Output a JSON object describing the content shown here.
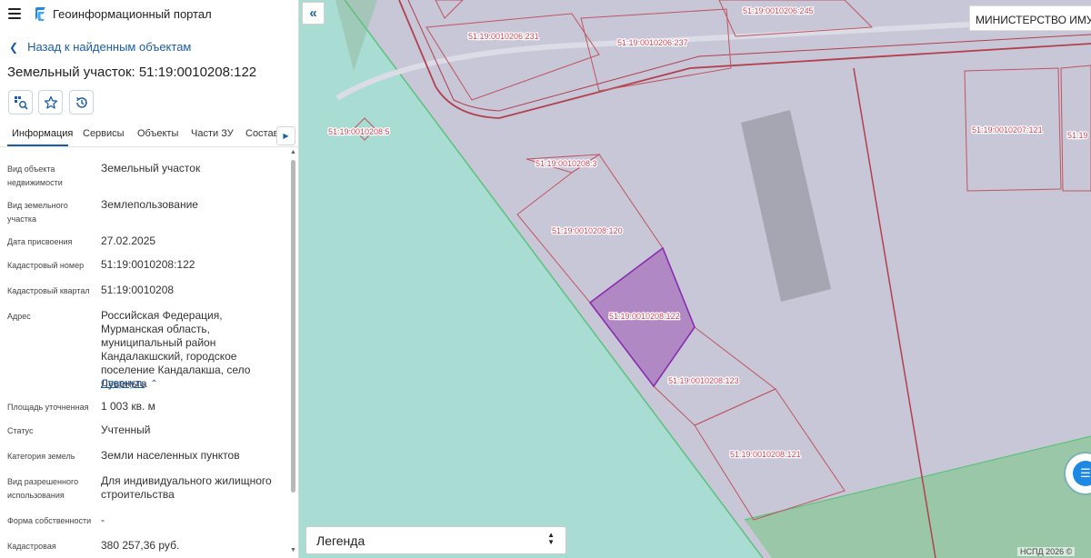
{
  "header": {
    "portal_title": "Геоинформационный портал",
    "menu_icon": "hamburger-icon",
    "logo_icon": "portal-logo-icon"
  },
  "back_link": "Назад к найденным объектам",
  "object_title": "Земельный участок: 51:19:0010208:122",
  "actions": [
    {
      "name": "search-on-map-button",
      "icon": "map-search-icon"
    },
    {
      "name": "favorite-button",
      "icon": "star-icon"
    },
    {
      "name": "history-button",
      "icon": "history-icon"
    }
  ],
  "tabs": [
    "Информация",
    "Сервисы",
    "Объекты",
    "Части ЗУ",
    "Состав"
  ],
  "active_tab": "Информация",
  "properties": [
    {
      "label": "Вид объекта недвижимости",
      "value": "Земельный участок"
    },
    {
      "label": "Вид земельного участка",
      "value": "Землепользование"
    },
    {
      "label": "Дата присвоения",
      "value": "27.02.2025"
    },
    {
      "label": "Кадастровый номер",
      "value": "51:19:0010208:122"
    },
    {
      "label": "Кадастровый квартал",
      "value": "51:19:0010208"
    },
    {
      "label": "Адрес",
      "value": "Российская Федерация, Мурманская область, муниципальный район Кандалакшский, городское поселение Кандалакша, село Лувеньга"
    },
    {
      "label": "Площадь уточненная",
      "value": "1 003 кв. м"
    },
    {
      "label": "Статус",
      "value": "Учтенный"
    },
    {
      "label": "Категория земель",
      "value": "Земли населенных пунктов"
    },
    {
      "label": "Вид разрешенного использования",
      "value": "Для индивидуального жилищного строительства"
    },
    {
      "label": "Форма собственности",
      "value": "-"
    },
    {
      "label": "Кадастровая",
      "value": "380 257,36 руб."
    }
  ],
  "collapse_link": "Свернуть",
  "map": {
    "parcel_labels": [
      "51:19:0010206:231",
      "51:19:0010206:237",
      "51:19:0010206:245",
      "51:19:0010208:5",
      "51:19:0010207:121",
      "51:19",
      "51:19:0010208:3",
      "51:19:0010208:120",
      "51:19:0010208:122",
      "51:19:0010208:123",
      "51:19:0010208:121"
    ],
    "ministry_text": "МИНИСТЕРСТВО ИМУЩ",
    "legend_label": "Легенда",
    "copyright": "НСПД 2026 ©",
    "colors": {
      "background": "#c7c7d8",
      "water_zone": "#a9ddd3",
      "zone_border": "#5cc27a",
      "selected_parcel": "#b088c4",
      "parcel_border": "#c0555f",
      "road": "#b3404d"
    }
  }
}
